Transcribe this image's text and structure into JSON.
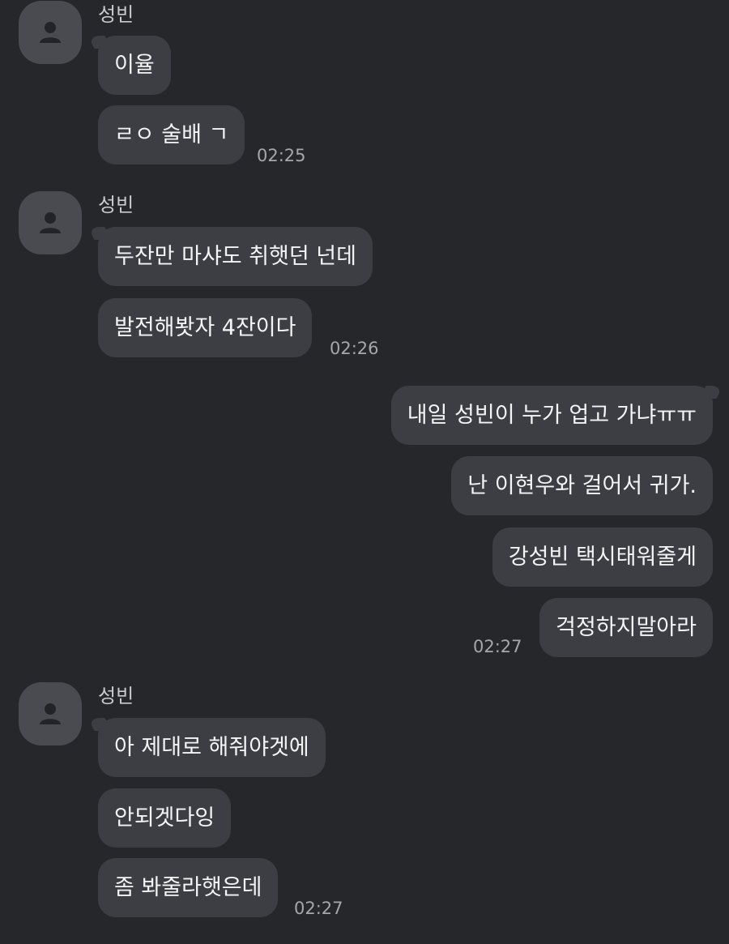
{
  "messages": {
    "group1": {
      "sender": "성빈",
      "bubbles": [
        "이율",
        "ㄹㅇ 술배 ㄱ"
      ],
      "time": "02:25"
    },
    "group2": {
      "sender": "성빈",
      "bubbles": [
        "두잔만 마샤도 취햇던 넌데",
        "발전해봣자 4잔이다"
      ],
      "time": "02:26"
    },
    "group3": {
      "bubbles": [
        "내일 성빈이 누가 업고 가냐ㅠㅠ",
        "난 이현우와 걸어서 귀가.",
        "강성빈 택시태워줄게",
        "걱정하지말아라"
      ],
      "time": "02:27"
    },
    "group4": {
      "sender": "성빈",
      "bubbles": [
        "아 제대로 해줘야겟에",
        "안되겟다잉",
        "좀 봐줄라햇은데"
      ],
      "time": "02:27"
    }
  },
  "icons": {
    "avatar": "person-icon"
  },
  "colors": {
    "background": "#26272b",
    "bubble": "#3d3e43",
    "avatar": "#4a4b50",
    "time": "#a6a7ab"
  }
}
